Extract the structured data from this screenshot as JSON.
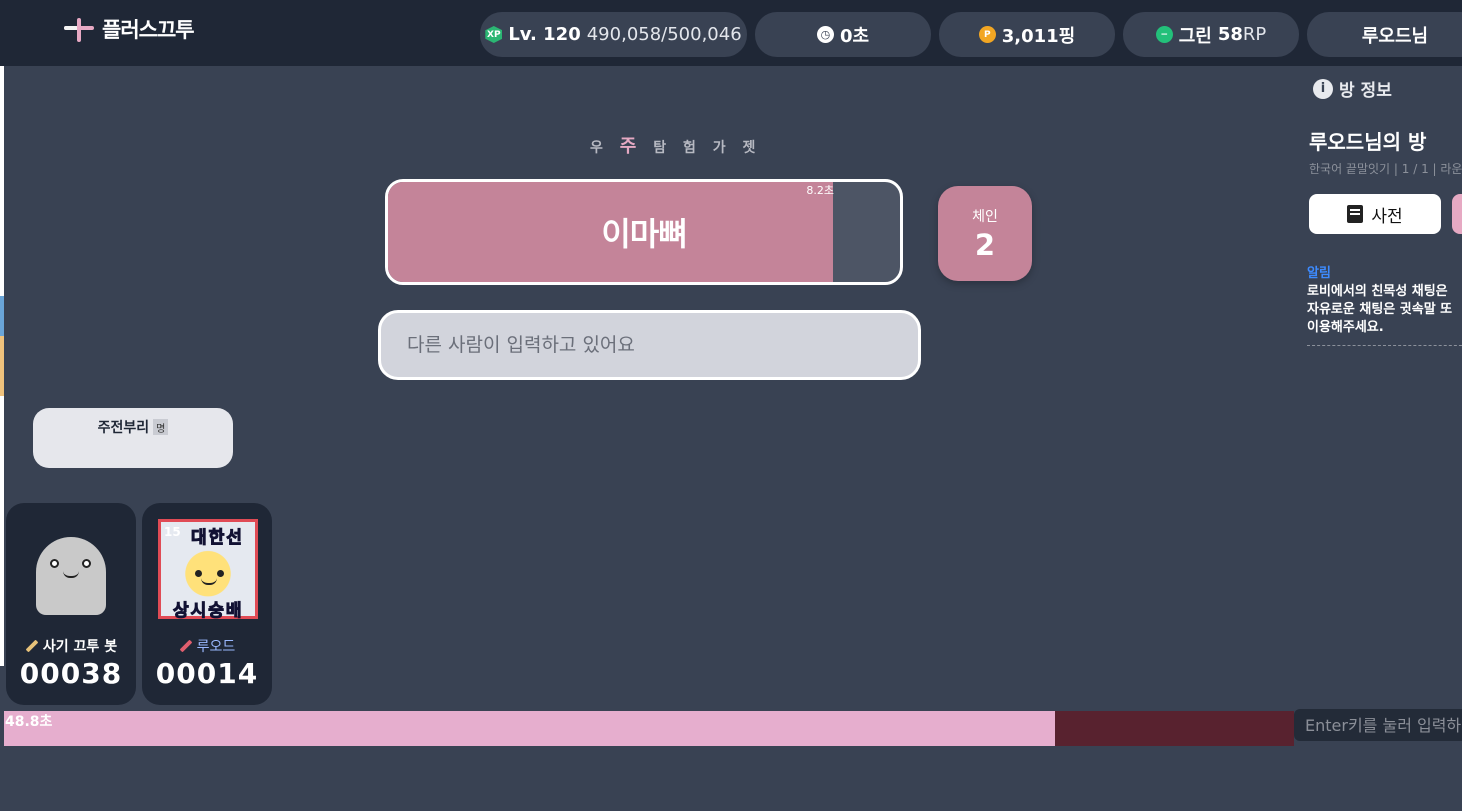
{
  "header": {
    "logo_text": "플러스끄투",
    "level_label": "Lv. 120",
    "xp_value": "490,058/500,046",
    "xp_icon": "XP",
    "time": "0초",
    "coin_icon": "P",
    "ping": "3,011핑",
    "rank_tier": "그린",
    "rank_value": "58",
    "rank_unit": "RP",
    "username": "루오드님"
  },
  "game": {
    "theme_pre": "우",
    "theme_highlight": "주",
    "theme_post": "탐 험 가 젯",
    "current_word": "이마뼈",
    "word_timer": "8.2초",
    "word_timer_fraction": 0.87,
    "chain_label": "체인",
    "chain_value": "2",
    "input_placeholder": "다른 사람이 입력하고 있어요"
  },
  "bubble": {
    "text": "주전부리",
    "tag": "명"
  },
  "players": [
    {
      "name": "사기 끄투 봇",
      "score": "00038"
    },
    {
      "name": "루오드",
      "score": "00014",
      "level": "15",
      "badge_top": "대한선",
      "badge_bottom": "상시숭배"
    }
  ],
  "round_timer": {
    "label": "48.8초",
    "fraction": 0.815
  },
  "chat": {
    "placeholder": "Enter키를 눌러 입력하"
  },
  "side": {
    "header": "방 정보",
    "room_title": "루오드님의 방",
    "room_sub": "한국어 끝말잇기 | 1 / 1 | 라운",
    "dict_button": "사전",
    "notice_label": "알림",
    "notice_line1": "로비에서의 친목성 채팅은",
    "notice_line2": "자유로운 채팅은 귓속말 또",
    "notice_line3": "이용해주세요."
  },
  "colors": {
    "accent_pink": "#c48499",
    "light_pink": "#e6aece",
    "background": "#394253",
    "topbar": "#1f2736"
  }
}
